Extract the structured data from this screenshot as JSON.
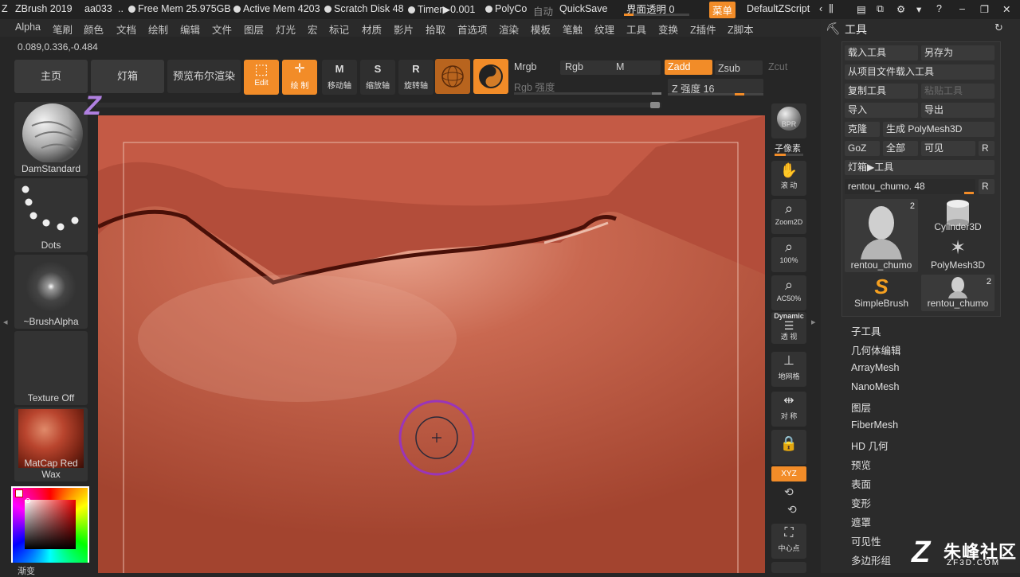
{
  "titlebar": {
    "app": "ZBrush 2019",
    "doc": "aa033",
    "ellipsis": "..",
    "free_mem": "Free Mem 25.975GB",
    "active_mem": "Active Mem 4203",
    "scratch": "Scratch Disk 48",
    "timer": "Timer▶0.001",
    "polycount": "PolyCo",
    "auto": "自动",
    "quicksave": "QuickSave",
    "transparency": "界面透明 0",
    "menu": "菜单",
    "zscript": "DefaultZScript"
  },
  "menubar": [
    "Alpha",
    "笔刷",
    "颜色",
    "文档",
    "绘制",
    "编辑",
    "文件",
    "图层",
    "灯光",
    "宏",
    "标记",
    "材质",
    "影片",
    "拾取",
    "首选项",
    "渲染",
    "模板",
    "笔触",
    "纹理",
    "工具",
    "变换",
    "Z插件",
    "Z脚本"
  ],
  "coords": "0.089,0.336,-0.484",
  "top_shelf": {
    "home": "主页",
    "lightbox": "灯箱",
    "bpr_preview": "预览布尔渲染",
    "edit": "Edit",
    "draw": "绘 制",
    "move": "移动轴",
    "scale": "缩放轴",
    "rotate": "旋转轴",
    "mrgb": "Mrgb",
    "rgb": "Rgb",
    "m": "M",
    "rgb_intensity": "Rgb 强度",
    "zadd": "Zadd",
    "zsub": "Zsub",
    "zcut": "Zcut",
    "z_intensity": "Z 强度 16",
    "z_intensity_value": 16
  },
  "left_panel": {
    "brush": "DamStandard",
    "stroke": "Dots",
    "alpha": "~BrushAlpha",
    "texture": "Texture Off",
    "material": "MatCap Red Wax",
    "gradient": "渐变"
  },
  "right_shelf": {
    "bpr": "BPR",
    "subpixel": "子像素",
    "scroll": "滚 动",
    "zoom2d": "Zoom2D",
    "p100": "100%",
    "ac50": "AC50%",
    "dynamic": "Dynamic",
    "persp": "透 视",
    "floor": "地网格",
    "local": "对 称",
    "xyz": "XYZ",
    "center": "中心点"
  },
  "tool_panel": {
    "title": "工具",
    "load_tool": "载入工具",
    "save_as": "另存为",
    "load_from_project": "从项目文件载入工具",
    "copy_tool": "复制工具",
    "paste_tool": "粘贴工具",
    "import": "导入",
    "export": "导出",
    "clone": "克隆",
    "make_polymesh": "生成 PolyMesh3D",
    "goz": "GoZ",
    "all": "全部",
    "visible": "可见",
    "r": "R",
    "lightbox_tool": "灯箱▶工具",
    "current_tool": "rentou_chumo. 48",
    "thumbs": [
      {
        "name": "rentou_chumo",
        "badge": "2"
      },
      {
        "name": "Cylinder3D",
        "badge": ""
      },
      {
        "name": "PolyMesh3D",
        "badge": ""
      },
      {
        "name": "SimpleBrush",
        "badge": ""
      },
      {
        "name": "rentou_chumo",
        "badge": "2"
      }
    ],
    "sections": [
      "子工具",
      "几何体编辑",
      "ArrayMesh",
      "NanoMesh",
      "图层",
      "FiberMesh",
      "HD 几何",
      "预览",
      "表面",
      "变形",
      "遮罩",
      "可见性",
      "多边形组"
    ]
  },
  "watermark": {
    "main": "朱峰社区",
    "sub": "ZF3D.COM"
  },
  "colors": {
    "accent": "#f28c28",
    "canvas": "#b14e3c",
    "cursor_outer": "#a040b0"
  }
}
